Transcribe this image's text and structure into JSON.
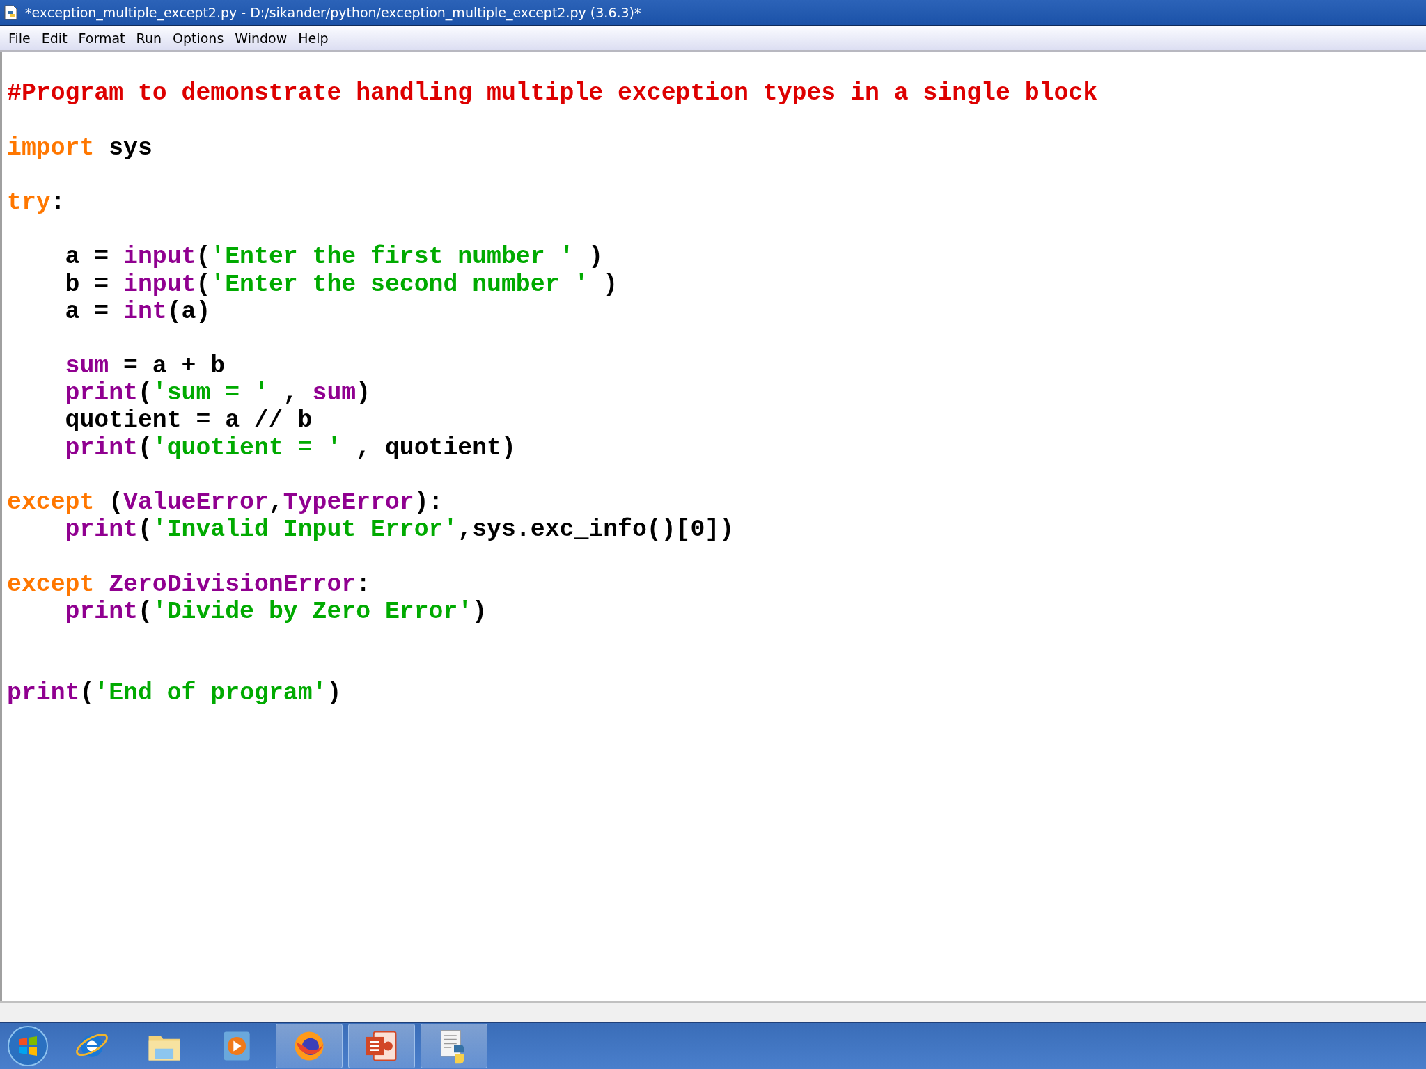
{
  "window": {
    "title": "*exception_multiple_except2.py - D:/sikander/python/exception_multiple_except2.py (3.6.3)*"
  },
  "menu": [
    "File",
    "Edit",
    "Format",
    "Run",
    "Options",
    "Window",
    "Help"
  ],
  "editor": {
    "lines": [
      {
        "kind": "blank"
      },
      {
        "kind": "code",
        "tokens": [
          {
            "kind": "comment",
            "text": "#Program to demonstrate handling multiple exception types in a single block"
          }
        ]
      },
      {
        "kind": "blank"
      },
      {
        "kind": "code",
        "tokens": [
          {
            "kind": "keyword",
            "text": "import"
          },
          {
            "kind": "plain",
            "text": " sys"
          }
        ]
      },
      {
        "kind": "blank"
      },
      {
        "kind": "code",
        "tokens": [
          {
            "kind": "keyword",
            "text": "try"
          },
          {
            "kind": "plain",
            "text": ":"
          }
        ]
      },
      {
        "kind": "blank"
      },
      {
        "kind": "code",
        "indented": true,
        "tokens": [
          {
            "kind": "plain",
            "text": "a = "
          },
          {
            "kind": "builtin",
            "text": "input"
          },
          {
            "kind": "plain",
            "text": "("
          },
          {
            "kind": "string",
            "text": "'Enter the first number '"
          },
          {
            "kind": "plain",
            "text": " )"
          }
        ]
      },
      {
        "kind": "code",
        "indented": true,
        "tokens": [
          {
            "kind": "plain",
            "text": "b = "
          },
          {
            "kind": "builtin",
            "text": "input"
          },
          {
            "kind": "plain",
            "text": "("
          },
          {
            "kind": "string",
            "text": "'Enter the second number '"
          },
          {
            "kind": "plain",
            "text": " )"
          }
        ]
      },
      {
        "kind": "code",
        "indented": true,
        "tokens": [
          {
            "kind": "plain",
            "text": "a = "
          },
          {
            "kind": "builtin",
            "text": "int"
          },
          {
            "kind": "plain",
            "text": "(a)"
          }
        ]
      },
      {
        "kind": "blank"
      },
      {
        "kind": "code",
        "indented": true,
        "tokens": [
          {
            "kind": "builtin",
            "text": "sum"
          },
          {
            "kind": "plain",
            "text": " = a + b"
          }
        ]
      },
      {
        "kind": "code",
        "indented": true,
        "tokens": [
          {
            "kind": "builtin",
            "text": "print"
          },
          {
            "kind": "plain",
            "text": "("
          },
          {
            "kind": "string",
            "text": "'sum = '"
          },
          {
            "kind": "plain",
            "text": " , "
          },
          {
            "kind": "builtin",
            "text": "sum"
          },
          {
            "kind": "plain",
            "text": ")"
          }
        ]
      },
      {
        "kind": "code",
        "indented": true,
        "tokens": [
          {
            "kind": "plain",
            "text": "quotient = a // b"
          }
        ]
      },
      {
        "kind": "code",
        "indented": true,
        "tokens": [
          {
            "kind": "builtin",
            "text": "print"
          },
          {
            "kind": "plain",
            "text": "("
          },
          {
            "kind": "string",
            "text": "'quotient = '"
          },
          {
            "kind": "plain",
            "text": " , quotient)"
          }
        ]
      },
      {
        "kind": "blank"
      },
      {
        "kind": "code",
        "tokens": [
          {
            "kind": "keyword",
            "text": "except"
          },
          {
            "kind": "plain",
            "text": " ("
          },
          {
            "kind": "builtin",
            "text": "ValueError"
          },
          {
            "kind": "plain",
            "text": ","
          },
          {
            "kind": "builtin",
            "text": "TypeError"
          },
          {
            "kind": "plain",
            "text": "):"
          }
        ]
      },
      {
        "kind": "code",
        "indented": true,
        "tokens": [
          {
            "kind": "builtin",
            "text": "print"
          },
          {
            "kind": "plain",
            "text": "("
          },
          {
            "kind": "string",
            "text": "'Invalid Input Error'"
          },
          {
            "kind": "plain",
            "text": ",sys.exc_info()[0])"
          }
        ]
      },
      {
        "kind": "blank"
      },
      {
        "kind": "code",
        "tokens": [
          {
            "kind": "keyword",
            "text": "except"
          },
          {
            "kind": "builtin",
            "text": "ZeroDivisionError",
            "spaced": true
          },
          {
            "kind": "plain",
            "text": ":"
          }
        ]
      },
      {
        "kind": "code",
        "indented": true,
        "tokens": [
          {
            "kind": "builtin",
            "text": "print"
          },
          {
            "kind": "plain",
            "text": "("
          },
          {
            "kind": "string",
            "text": "'Divide by Zero Error'"
          },
          {
            "kind": "plain",
            "text": ")"
          }
        ]
      },
      {
        "kind": "blank"
      },
      {
        "kind": "blank"
      },
      {
        "kind": "code",
        "tokens": [
          {
            "kind": "builtin",
            "text": "print"
          },
          {
            "kind": "plain",
            "text": "("
          },
          {
            "kind": "string",
            "text": "'End of program'"
          },
          {
            "kind": "plain",
            "text": ")"
          }
        ]
      }
    ]
  },
  "taskbar": {
    "items": [
      {
        "running": false
      },
      {
        "running": false
      },
      {
        "running": false
      },
      {
        "running": true
      },
      {
        "running": true
      },
      {
        "running": true
      }
    ]
  }
}
